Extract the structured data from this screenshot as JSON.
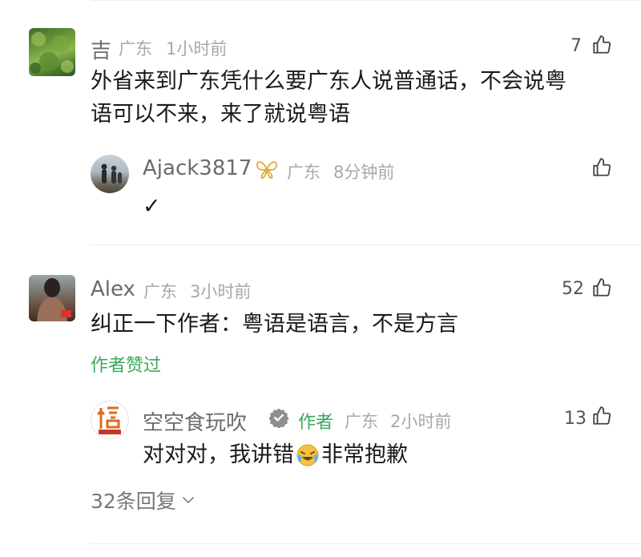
{
  "comments": [
    {
      "user": "吉",
      "location": "广东",
      "time": "1小时前",
      "likes": "7",
      "text_line1": "外省来到广东凭什么要广东人说普通话，不会说粤",
      "text_line2": "语可以不来，来了就说粤语",
      "reply": {
        "user": "Ajack3817",
        "location": "广东",
        "time": "8分钟前",
        "text": "✓"
      }
    },
    {
      "user": "Alex",
      "location": "广东",
      "time": "3小时前",
      "likes": "52",
      "text": "纠正一下作者：粤语是语言，不是方言",
      "author_liked": "作者赞过",
      "reply": {
        "user": "空空食玩吹",
        "author_tag": "作者",
        "location": "广东",
        "time": "2小时前",
        "likes": "13",
        "text_before_emoji": "对对对，我讲错",
        "text_after_emoji": "非常抱歉",
        "emoji": "crying-laughing-emoji"
      },
      "more_replies": "32条回复"
    }
  ],
  "icons": {
    "like": "thumbs-up-icon",
    "vip_badge": "butterfly-badge-icon",
    "verified": "verified-check-icon",
    "chevron": "chevron-down-icon"
  },
  "colors": {
    "accent_green": "#3aa85a",
    "meta_gray": "#a8a8a8",
    "name_gray": "#6b6b6b"
  }
}
